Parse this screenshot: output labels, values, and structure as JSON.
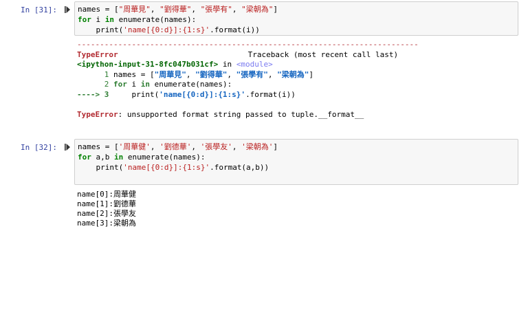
{
  "cell1": {
    "prompt": "In [31]:",
    "code": {
      "l1_a": "names = [",
      "l1_s1": "\"周華見\"",
      "l1_c1": ", ",
      "l1_s2": "\"劉得華\"",
      "l1_c2": ", ",
      "l1_s3": "\"張學有\"",
      "l1_c3": ", ",
      "l1_s4": "\"梁朝為\"",
      "l1_e": "]",
      "l2_kw1": "for",
      "l2_a": " i ",
      "l2_kw2": "in",
      "l2_b": " enumerate(names):",
      "l3_a": "    print(",
      "l3_s": "'name[{0:d}]:{1:s}'",
      "l3_b": ".format(i))"
    },
    "traceback": {
      "rule": "---------------------------------------------------------------------------",
      "err_name": "TypeError",
      "header_right": "Traceback (most recent call last)",
      "loc": "<ipython-input-31-8fc047b031cf>",
      "loc_in": " in ",
      "loc_mod": "<module>",
      "f1_no": "      1",
      "f1_a": " names = [",
      "f1_s1": "\"周華見\"",
      "f1_c1": ", ",
      "f1_s2": "\"劉得華\"",
      "f1_c2": ", ",
      "f1_s3": "\"張學有\"",
      "f1_c3": ", ",
      "f1_s4": "\"梁朝為\"",
      "f1_e": "]",
      "f2_no": "      2",
      "f2_kw1": " for",
      "f2_a": " i ",
      "f2_kw2": "in",
      "f2_b": " enumerate(names):",
      "f3_arrow": "----> 3",
      "f3_a": "     print(",
      "f3_s": "'name[{0:d}]:{1:s}'",
      "f3_b": ".format(i))",
      "final_name": "TypeError",
      "final_msg": ": unsupported format string passed to tuple.__format__"
    }
  },
  "cell2": {
    "prompt": "In [32]:",
    "code": {
      "l1_a": "names = [",
      "l1_s1": "'周華健'",
      "l1_c1": ", ",
      "l1_s2": "'劉德華'",
      "l1_c2": ", ",
      "l1_s3": "'張學友'",
      "l1_c3": ", ",
      "l1_s4": "'梁朝為'",
      "l1_e": "]",
      "l2_kw1": "for",
      "l2_a": " a,b ",
      "l2_kw2": "in",
      "l2_b": " enumerate(names):",
      "l3_a": "    print(",
      "l3_s": "'name[{0:d}]:{1:s}'",
      "l3_b": ".format(a,b))"
    },
    "stdout": [
      "name[0]:周華健",
      "name[1]:劉德華",
      "name[2]:張學友",
      "name[3]:梁朝為"
    ]
  }
}
